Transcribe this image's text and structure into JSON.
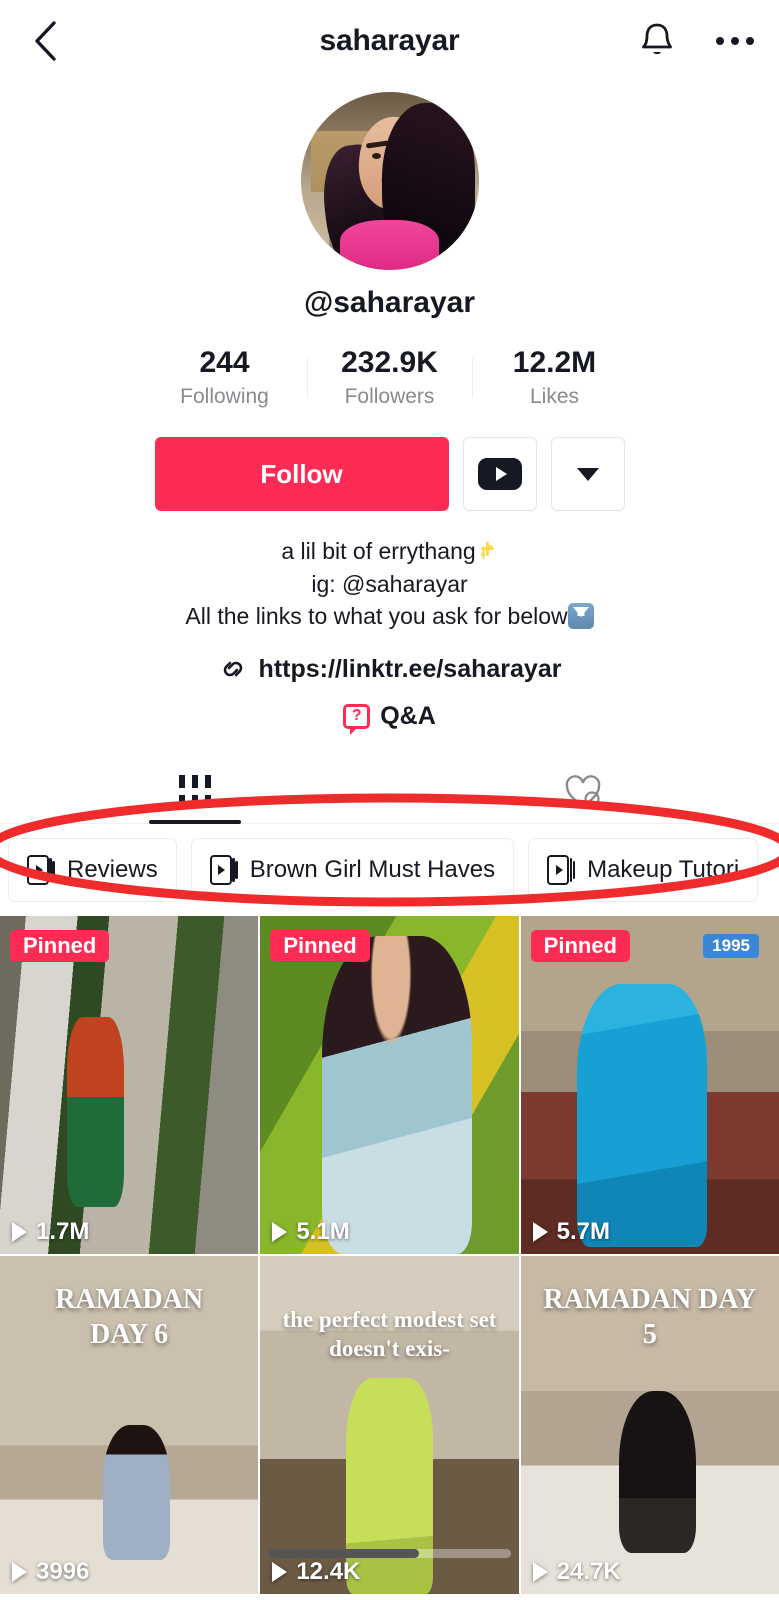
{
  "header": {
    "title": "saharayar",
    "back_icon": "chevron-left-icon",
    "bell_icon": "bell-icon",
    "more_icon": "more-options-icon"
  },
  "profile": {
    "avatar_alt": "profile-photo",
    "handle": "@saharayar"
  },
  "stats": [
    {
      "value": "244",
      "label": "Following"
    },
    {
      "value": "232.9K",
      "label": "Followers"
    },
    {
      "value": "12.2M",
      "label": "Likes"
    }
  ],
  "actions": {
    "follow_label": "Follow",
    "youtube_icon": "youtube-icon",
    "more_caret_icon": "chevron-down-icon"
  },
  "bio": {
    "line1": "a lil bit of errythang",
    "line2": "ig: @saharayar",
    "line3": "All the links to what you ask for below",
    "link": "https://linktr.ee/saharayar",
    "link_icon": "link-icon",
    "qa_label": "Q&A",
    "qa_icon": "question-bubble-icon"
  },
  "tabs": [
    {
      "name": "videos-tab",
      "icon": "grid-icon",
      "active": true
    },
    {
      "name": "liked-tab",
      "icon": "heart-slash-icon",
      "active": false
    }
  ],
  "playlists": [
    {
      "label": "Reviews",
      "icon": "playlist-icon"
    },
    {
      "label": "Brown Girl Must Haves",
      "icon": "playlist-icon"
    },
    {
      "label": "Makeup Tutori",
      "icon": "playlist-icon"
    }
  ],
  "annotation": {
    "shape": "ellipse",
    "color": "#ef2b2b",
    "stroke_width": 8
  },
  "colors": {
    "accent": "#FE2C55",
    "text": "#161823",
    "muted": "#8A8B91",
    "badge_blue": "#3A87D8"
  },
  "videos": [
    {
      "views": "1.7M",
      "pinned": "Pinned",
      "overlay": "",
      "year": "",
      "art": "t1",
      "scrubber": false
    },
    {
      "views": "5.1M",
      "pinned": "Pinned",
      "overlay": "",
      "year": "",
      "art": "t2",
      "scrubber": false
    },
    {
      "views": "5.7M",
      "pinned": "Pinned",
      "overlay": "",
      "year": "1995",
      "art": "t3",
      "scrubber": false
    },
    {
      "views": "3996",
      "pinned": "",
      "overlay": "RAMADAN\nDAY 6",
      "year": "",
      "art": "t4",
      "scrubber": false
    },
    {
      "views": "12.4K",
      "pinned": "",
      "overlay": "the perfect modest set\ndoesn't exis-",
      "year": "",
      "art": "t5",
      "scrubber": true
    },
    {
      "views": "24.7K",
      "pinned": "",
      "overlay": "RAMADAN DAY\n5",
      "year": "",
      "art": "t6",
      "scrubber": false
    }
  ]
}
